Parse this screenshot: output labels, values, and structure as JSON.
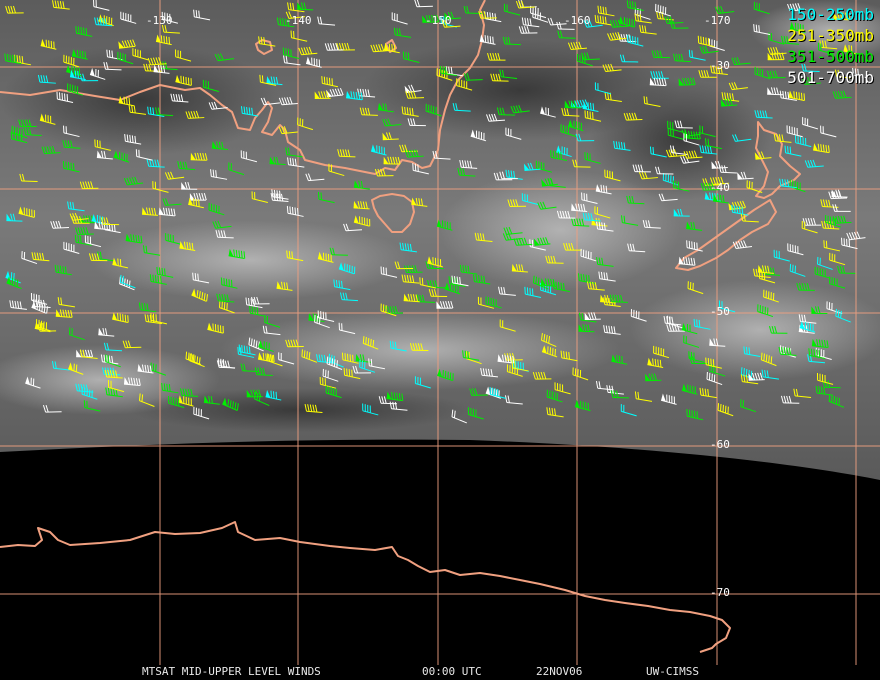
{
  "image": {
    "colors": {
      "background_space": "#000000",
      "cloud_field": "#6a6a6a",
      "grid_lines": "#f0a080",
      "coastlines": "#f0a080"
    }
  },
  "legend": [
    {
      "label": "150-250mb",
      "color": "#00ffff"
    },
    {
      "label": "251-350mb",
      "color": "#ffff00"
    },
    {
      "label": "351-500mb",
      "color": "#00ee00"
    },
    {
      "label": "501-700mb",
      "color": "#ffffff"
    }
  ],
  "longitude_labels": [
    "-130",
    "-140",
    "-150",
    "-160",
    "-170"
  ],
  "latitude_labels": [
    "-30",
    "-40",
    "-50",
    "-60",
    "-70"
  ],
  "footer": {
    "product": "MTSAT MID-UPPER LEVEL WINDS",
    "time": "00:00 UTC",
    "date": "22NOV06",
    "source": "UW-CIMSS"
  },
  "wind_barbs": {
    "icon": "wind-barb-icon",
    "description_levels": [
      "150-250mb",
      "251-350mb",
      "351-500mb",
      "501-700mb"
    ]
  }
}
